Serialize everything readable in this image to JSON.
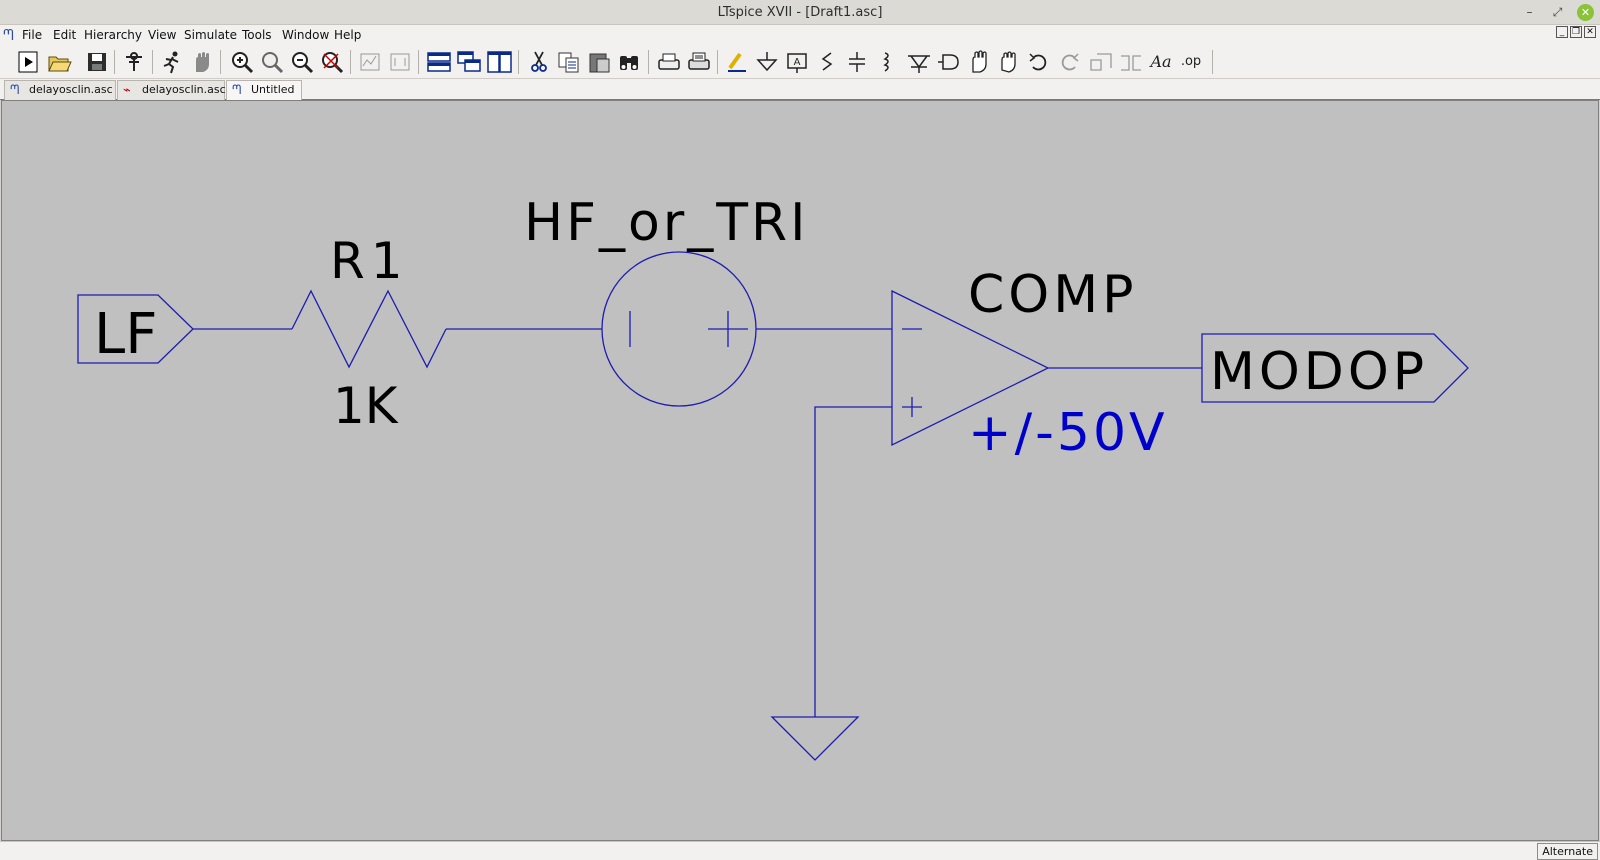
{
  "window": {
    "title": "LTspice XVII - [Draft1.asc]"
  },
  "menu": {
    "items": [
      "File",
      "Edit",
      "Hierarchy",
      "View",
      "Simulate",
      "Tools",
      "Window",
      "Help"
    ]
  },
  "toolbar": {
    "buttons": [
      "run-icon",
      "open-icon",
      "save-icon",
      "control-panel-icon",
      "run-simulation-icon",
      "halt-icon",
      "zoom-in-icon",
      "zoom-pan-icon",
      "zoom-out-icon",
      "zoom-fit-icon",
      "autorange-icon",
      "delete-trace-icon",
      "tile-horizontal-icon",
      "cascade-icon",
      "tile-vertical-icon",
      "cut-icon",
      "copy-icon",
      "paste-icon",
      "find-icon",
      "print-preview-icon",
      "print-icon",
      "wire-icon",
      "ground-icon",
      "label-net-icon",
      "resistor-icon",
      "capacitor-icon",
      "inductor-icon",
      "diode-icon",
      "component-icon",
      "move-icon",
      "drag-icon",
      "undo-icon",
      "redo-icon",
      "rotate-icon",
      "mirror-icon",
      "text-icon",
      "spice-directive-icon"
    ],
    "spice_directive_label": ".op",
    "text_label": "Aa"
  },
  "tabs": [
    {
      "label": "delayosclin.asc",
      "icon": "schematic-icon"
    },
    {
      "label": "delayosclin.asc",
      "icon": "waveform-icon"
    },
    {
      "label": "Untitled",
      "icon": "schematic-icon",
      "active": true
    }
  ],
  "schematic": {
    "colors": {
      "wire": "#1c1cb0",
      "text": "#000000",
      "value_text": "#0000cc",
      "background": "#c0c0c0"
    },
    "labels": {
      "input_port": "LF",
      "resistor_name": "R1",
      "resistor_value": "1K",
      "source_name": "HF_or_TRI",
      "comparator_name": "COMP",
      "comparator_value": "+/-50V",
      "output_port": "MODOP"
    }
  },
  "status": {
    "mode": "Alternate"
  }
}
